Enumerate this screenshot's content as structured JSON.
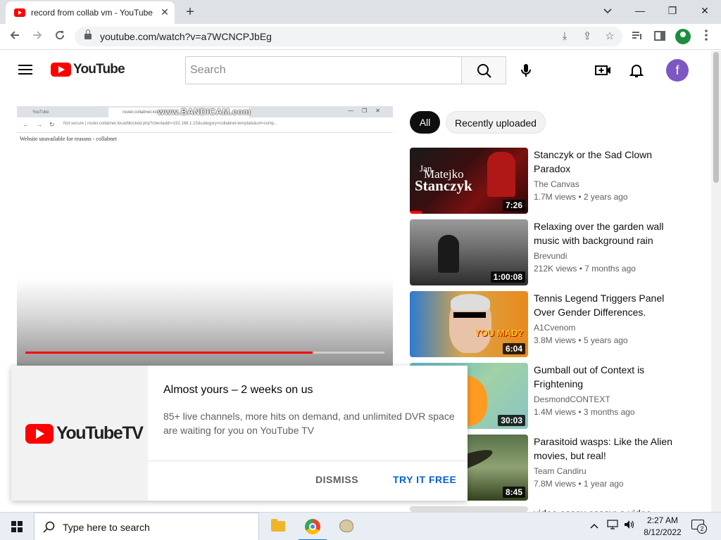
{
  "browser": {
    "tab_title": "record from collab vm - YouTube",
    "tab_close": "✕",
    "new_tab": "+",
    "url": "youtube.com/watch?v=a7WCNCPJbEg",
    "window_controls": {
      "minimize": "—",
      "restore": "❐",
      "close": "✕"
    }
  },
  "youtube": {
    "logo_text": "YouTube",
    "search_placeholder": "Search",
    "avatar_letter": "f"
  },
  "player": {
    "watermark": "www.BANDICAM.com",
    "inner_tab1": "YouTube",
    "inner_tab2": "router.collabnet.local",
    "inner_url": "Not secure  |  router.collabnet.local/blocked.php?clientaddr=192.168.1.15&category=collabnet-template&url=comp...",
    "inner_message": "Website unavailable for reasons - collabnet",
    "progress_fraction": 0.8
  },
  "chips": {
    "all": "All",
    "recent": "Recently uploaded"
  },
  "recommendations": [
    {
      "title": "Stanczyk or the Sad Clown Paradox",
      "channel": "The Canvas",
      "meta": "1.7M views • 2 years ago",
      "duration": "7:26",
      "watched_fraction": 0.1,
      "thumb_text": [
        "Jan",
        "Matejko",
        "Stanczyk"
      ]
    },
    {
      "title": "Relaxing over the garden wall music with background rain",
      "channel": "Brevundi",
      "meta": "212K views • 7 months ago",
      "duration": "1:00:08"
    },
    {
      "title": "Tennis Legend Triggers Panel Over Gender Differences.",
      "channel": "A1Cvenom",
      "meta": "3.8M views • 5 years ago",
      "duration": "6:04",
      "thumb_text": [
        "YOU MAD?"
      ]
    },
    {
      "title": "Gumball out of Context is Frightening",
      "channel": "DesmondCONTEXT",
      "meta": "1.4M views • 3 months ago",
      "duration": "30:03"
    },
    {
      "title": "Parasitoid wasps: Like the Alien movies, but real!",
      "channel": "Team Candiru",
      "meta": "7.8M views • 1 year ago",
      "duration": "8:45"
    },
    {
      "title": "video essay essay: a video"
    }
  ],
  "promo": {
    "logo_text": "YouTubeTV",
    "title": "Almost yours – 2 weeks on us",
    "body": "85+ live channels, more hits on demand, and unlimited DVR space are waiting for you on YouTube TV",
    "dismiss": "DISMISS",
    "try": "TRY IT FREE"
  },
  "taskbar": {
    "search_text": "Type here to search",
    "time": "2:27 AM",
    "date": "8/12/2022",
    "notification_count": "2"
  },
  "colors": {
    "youtube_red": "#ff0000",
    "link_blue": "#065fd4",
    "avatar_purple": "#7e57c2"
  }
}
